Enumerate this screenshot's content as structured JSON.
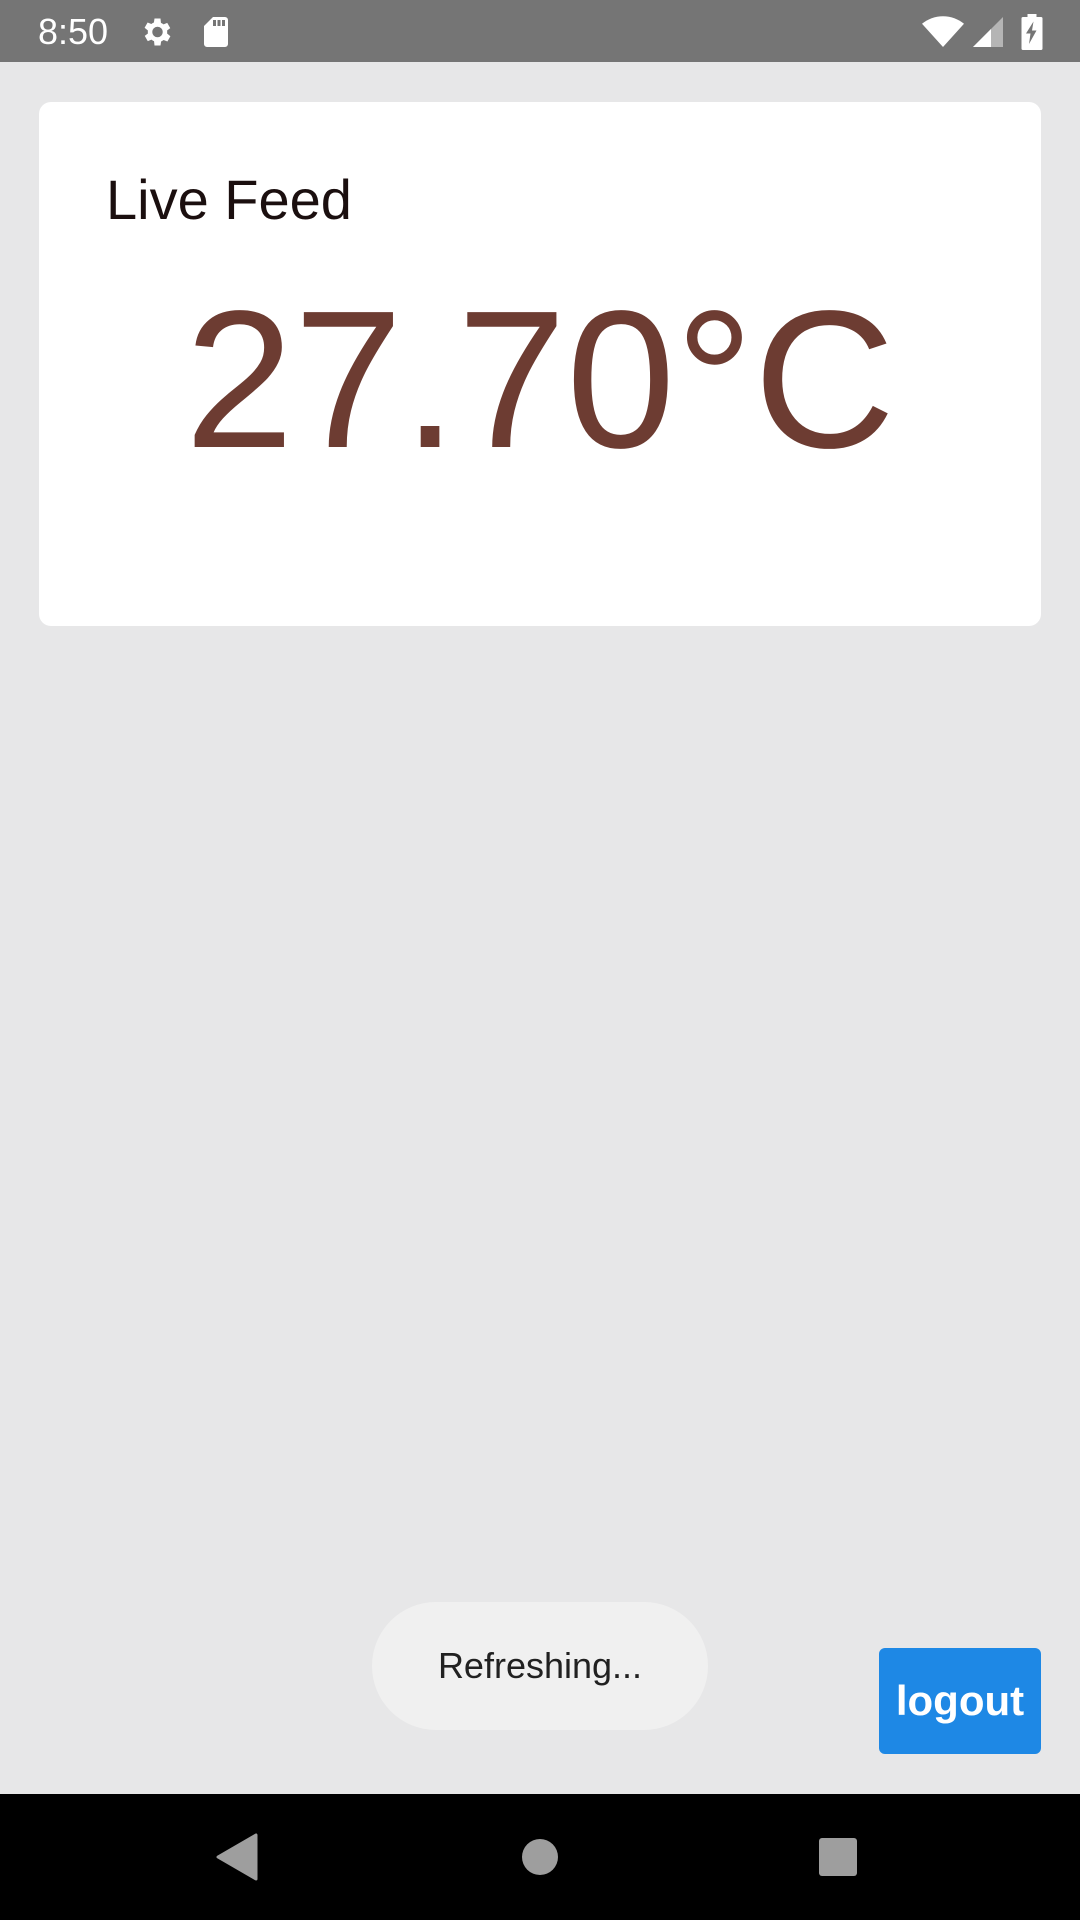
{
  "status_bar": {
    "time": "8:50",
    "left_icons": [
      "gear-icon",
      "sd-card-icon"
    ],
    "right_icons": [
      "wifi-icon",
      "cell-signal-icon",
      "battery-charging-icon"
    ]
  },
  "card": {
    "title": "Live Feed",
    "temperature": "27.70°C"
  },
  "toast": {
    "text": "Refreshing..."
  },
  "logout_button": {
    "label": "logout"
  },
  "nav_bar": {
    "buttons": [
      "back-icon",
      "home-icon",
      "recents-icon"
    ]
  },
  "colors": {
    "status_bar": "#757575",
    "background": "#e7e7e8",
    "card": "#ffffff",
    "temperature_text": "#6d3c32",
    "logout_button": "#1e88e5",
    "nav_bar": "#000000"
  }
}
